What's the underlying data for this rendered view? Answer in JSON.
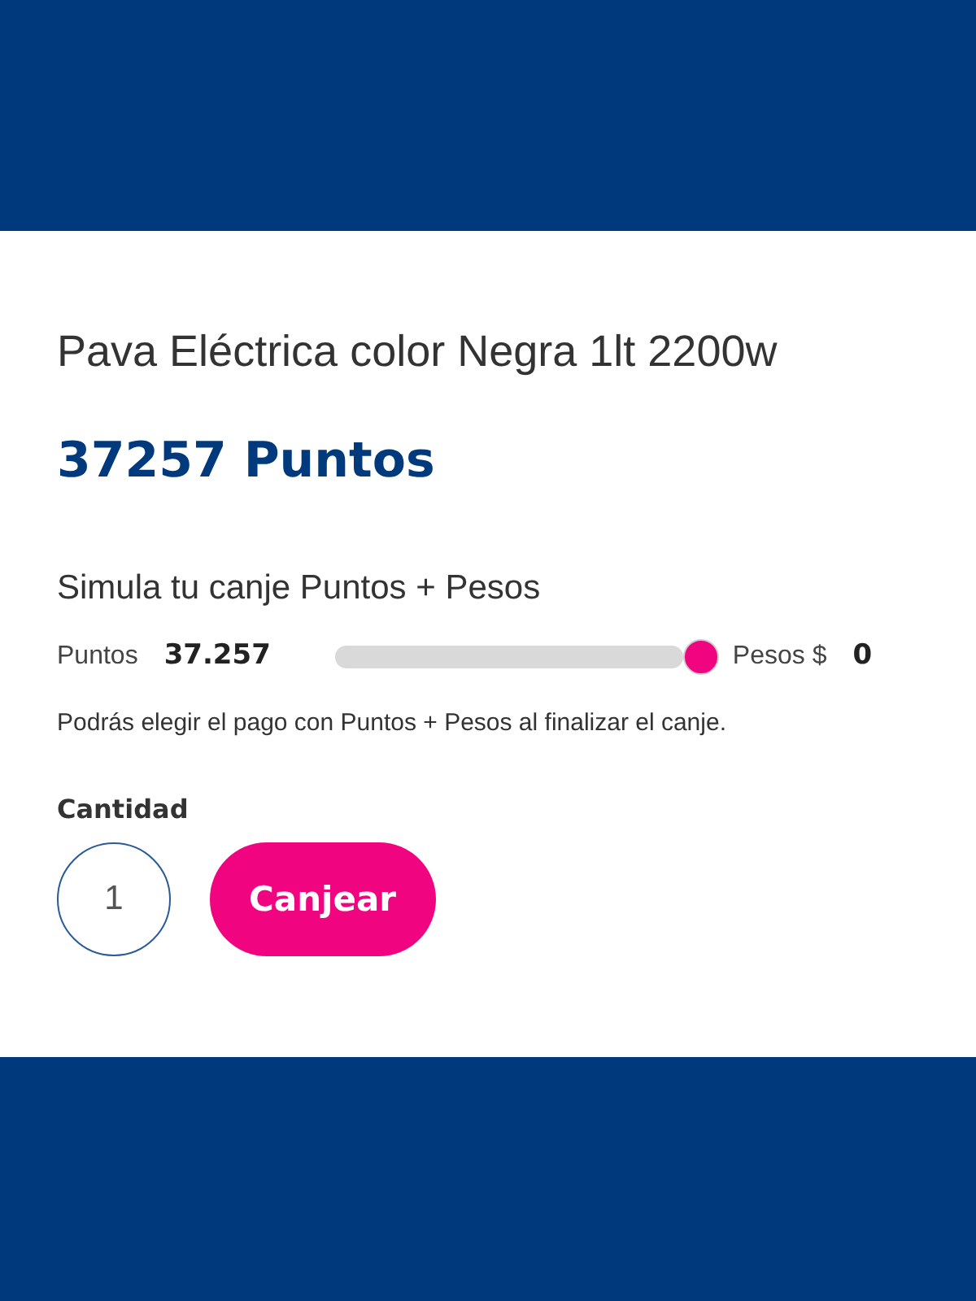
{
  "product": {
    "title": "Pava Eléctrica color Negra 1lt 2200w",
    "points": "37257 Puntos"
  },
  "simulator": {
    "heading": "Simula tu canje Puntos + Pesos",
    "points_label": "Puntos",
    "points_value": "37.257",
    "level": 1,
    "pesos_label": "Pesos $",
    "pesos_value": "0",
    "note": "Podrás elegir el pago con Puntos + Pesos al finalizar el canje."
  },
  "quantity": {
    "label": "Cantidad",
    "value": "1"
  },
  "buttons": [
    "Canjear"
  ]
}
